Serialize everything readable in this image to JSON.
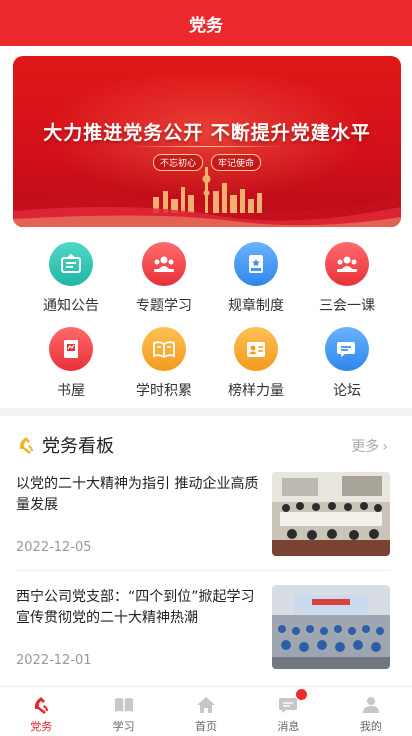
{
  "header": {
    "title": "党务"
  },
  "banner": {
    "headline": "大力推进党务公开  不断提升党建水平",
    "tags": [
      "不忘初心",
      "牢记使命"
    ]
  },
  "menu": [
    {
      "label": "通知公告",
      "icon": "notice-icon",
      "color": "#2bc3b1"
    },
    {
      "label": "专题学习",
      "icon": "group-study-icon",
      "color": "#f04848"
    },
    {
      "label": "规章制度",
      "icon": "rules-book-icon",
      "color": "#3c97f2"
    },
    {
      "label": "三会一课",
      "icon": "meeting-icon",
      "color": "#f04848"
    },
    {
      "label": "书屋",
      "icon": "bookshelf-icon",
      "color": "#f04848"
    },
    {
      "label": "学时积累",
      "icon": "open-book-icon",
      "color": "#f7a531"
    },
    {
      "label": "榜样力量",
      "icon": "role-model-icon",
      "color": "#f7a531"
    },
    {
      "label": "论坛",
      "icon": "chat-icon",
      "color": "#3c97f2"
    }
  ],
  "board": {
    "title": "党务看板",
    "more": "更多",
    "items": [
      {
        "title": "以党的二十大精神为指引 推动企业高质量发展",
        "date": "2022-12-05"
      },
      {
        "title": "西宁公司党支部：“四个到位”掀起学习宣传贯彻党的二十大精神热潮",
        "date": "2022-12-01"
      }
    ]
  },
  "tabs": [
    {
      "label": "党务",
      "icon": "party-emblem-icon",
      "active": true
    },
    {
      "label": "学习",
      "icon": "book-icon",
      "active": false
    },
    {
      "label": "首页",
      "icon": "home-icon",
      "active": false
    },
    {
      "label": "消息",
      "icon": "message-icon",
      "active": false
    },
    {
      "label": "我的",
      "icon": "user-icon",
      "active": false
    }
  ],
  "colors": {
    "brand": "#ec2a2e",
    "active_tab": "#e5272c",
    "badge": "#f02b2b"
  }
}
